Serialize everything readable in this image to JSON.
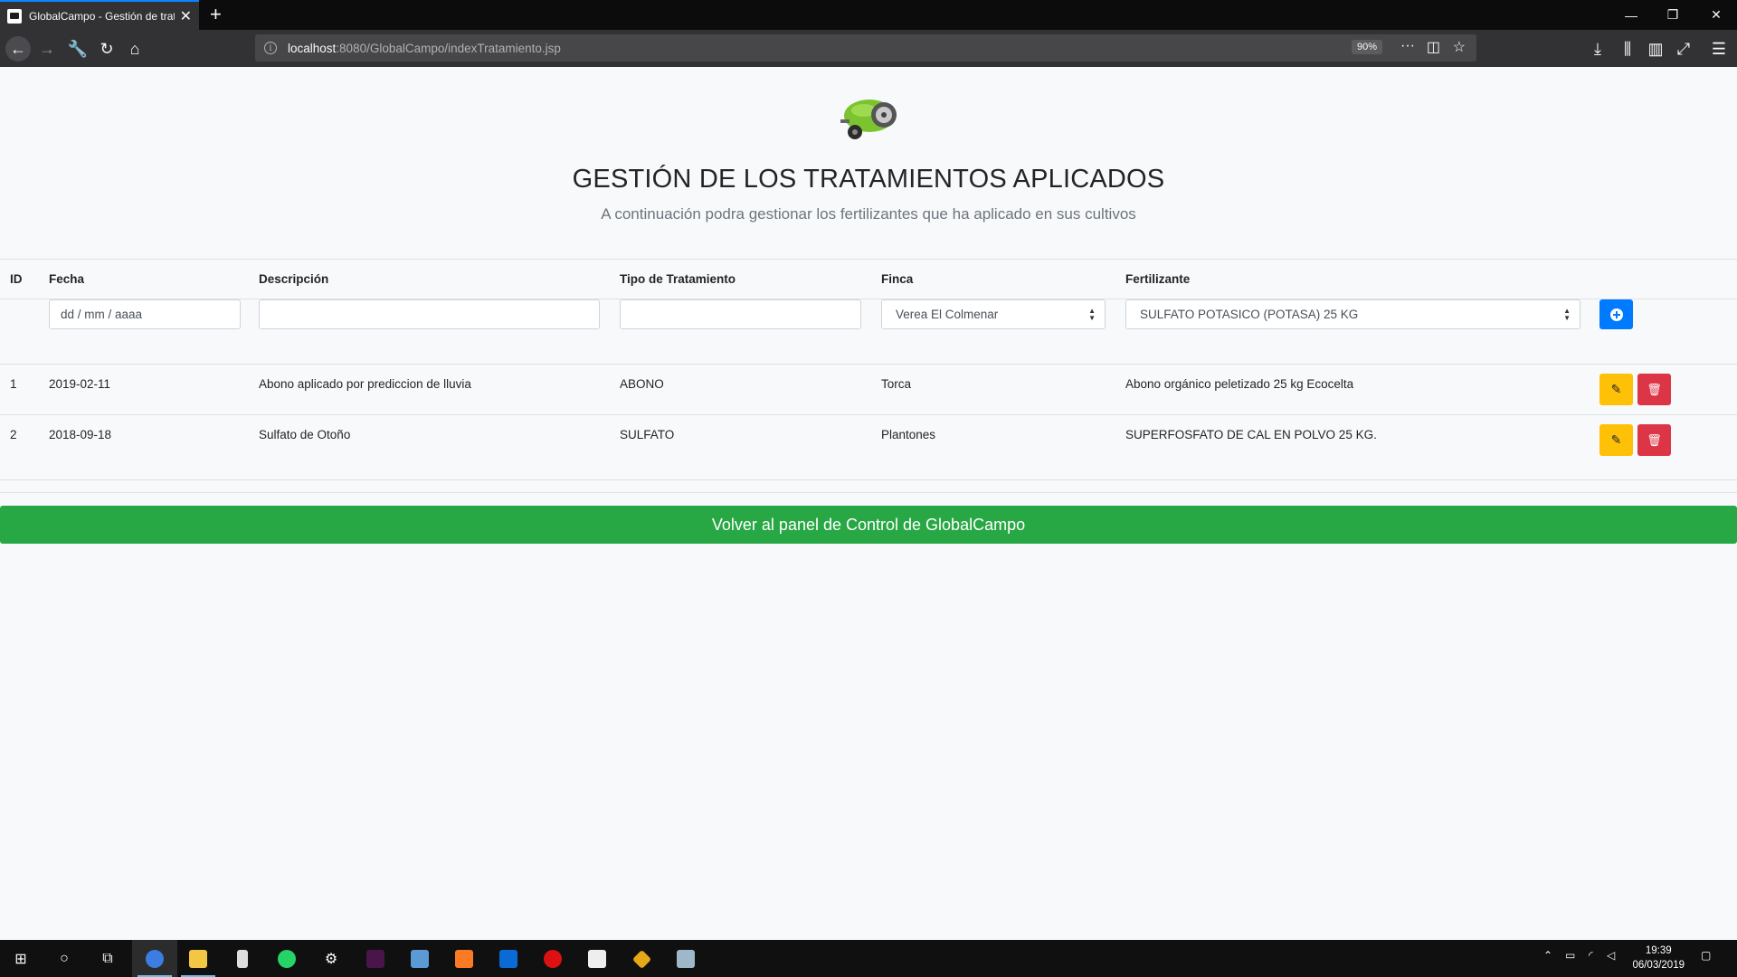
{
  "browser": {
    "tab_title": "GlobalCampo - Gestión de trat",
    "url_host": "localhost",
    "url_path": ":8080/GlobalCampo/indexTratamiento.jsp",
    "zoom": "90%"
  },
  "page": {
    "title": "GESTIÓN DE LOS TRATAMIENTOS APLICADOS",
    "subtitle": "A continuación podra gestionar los fertilizantes que ha aplicado en sus cultivos",
    "back_button": "Volver al panel de Control de GlobalCampo"
  },
  "table": {
    "headers": [
      "ID",
      "Fecha",
      "Descripción",
      "Tipo de Tratamiento",
      "Finca",
      "Fertilizante"
    ],
    "form": {
      "date_placeholder": "dd / mm / aaaa",
      "desc_value": "",
      "type_value": "",
      "finca_selected": "Verea El Colmenar",
      "fert_selected": "SULFATO POTASICO (POTASA) 25 KG"
    },
    "rows": [
      {
        "id": "1",
        "fecha": "2019-02-11",
        "descripcion": "Abono aplicado por prediccion de lluvia",
        "tipo": "ABONO",
        "finca": "Torca",
        "fertilizante": "Abono orgánico peletizado 25 kg Ecocelta"
      },
      {
        "id": "2",
        "fecha": "2018-09-18",
        "descripcion": "Sulfato de Otoño",
        "tipo": "SULFATO",
        "finca": "Plantones",
        "fertilizante": "SUPERFOSFATO DE CAL EN POLVO 25 KG."
      }
    ]
  },
  "taskbar": {
    "time": "19:39",
    "date": "06/03/2019"
  },
  "colors": {
    "primary": "#007bff",
    "warning": "#ffc107",
    "danger": "#dc3545",
    "success": "#28a745"
  }
}
